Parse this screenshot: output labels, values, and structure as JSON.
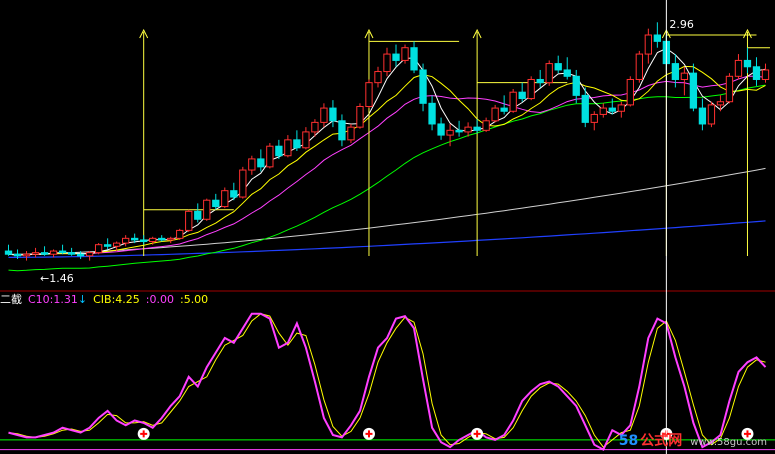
{
  "colors": {
    "background": "#000000",
    "up_candle": "#ff3030",
    "down_candle": "#00e0e0",
    "ma5": "#ffffff",
    "ma10": "#ffff00",
    "ma20": "#ff40ff",
    "ma60": "#00ff00",
    "ma120": "#d0d0d0",
    "ma250": "#2040ff",
    "signal": "#ffff40",
    "indicator_line": "#ff40ff",
    "indicator_signal": "#ffff00",
    "green_level": "#00ff00",
    "magenta_level": "#ff40ff"
  },
  "price_panel": {
    "max_label": "2.96",
    "min_label": "1.46",
    "min_arrow": "←"
  },
  "indicator_panel": {
    "name": "二截",
    "c10_label": "C10:1.31",
    "c10_arrow": "↓",
    "cib_label": "CIB:4.25",
    "v1_label": ":0.00",
    "v2_label": ":5.00"
  },
  "watermark": {
    "num": "58",
    "cn": "公式网",
    "url": "www.58gu.com"
  },
  "chart_data": {
    "type": "candlestick",
    "price_ylim": [
      1.3,
      3.05
    ],
    "indicator_ylim": [
      -0.5,
      5.6
    ],
    "ohlc": [
      [
        1.52,
        1.56,
        1.49,
        1.5
      ],
      [
        1.5,
        1.53,
        1.47,
        1.49
      ],
      [
        1.49,
        1.52,
        1.46,
        1.5
      ],
      [
        1.5,
        1.54,
        1.48,
        1.51
      ],
      [
        1.51,
        1.55,
        1.49,
        1.5
      ],
      [
        1.5,
        1.53,
        1.48,
        1.52
      ],
      [
        1.52,
        1.56,
        1.5,
        1.51
      ],
      [
        1.51,
        1.54,
        1.49,
        1.5
      ],
      [
        1.5,
        1.52,
        1.47,
        1.49
      ],
      [
        1.49,
        1.52,
        1.46,
        1.51
      ],
      [
        1.51,
        1.57,
        1.5,
        1.56
      ],
      [
        1.56,
        1.6,
        1.53,
        1.55
      ],
      [
        1.55,
        1.58,
        1.52,
        1.57
      ],
      [
        1.57,
        1.62,
        1.55,
        1.6
      ],
      [
        1.6,
        1.63,
        1.57,
        1.59
      ],
      [
        1.59,
        1.62,
        1.56,
        1.58
      ],
      [
        1.58,
        1.61,
        1.56,
        1.6
      ],
      [
        1.6,
        1.62,
        1.58,
        1.59
      ],
      [
        1.59,
        1.61,
        1.57,
        1.6
      ],
      [
        1.6,
        1.66,
        1.59,
        1.65
      ],
      [
        1.65,
        1.78,
        1.64,
        1.77
      ],
      [
        1.77,
        1.82,
        1.7,
        1.72
      ],
      [
        1.72,
        1.85,
        1.71,
        1.84
      ],
      [
        1.84,
        1.88,
        1.78,
        1.8
      ],
      [
        1.8,
        1.92,
        1.79,
        1.9
      ],
      [
        1.9,
        1.95,
        1.84,
        1.86
      ],
      [
        1.86,
        2.05,
        1.85,
        2.03
      ],
      [
        2.03,
        2.12,
        2.0,
        2.1
      ],
      [
        2.1,
        2.16,
        2.02,
        2.05
      ],
      [
        2.05,
        2.2,
        2.04,
        2.18
      ],
      [
        2.18,
        2.22,
        2.1,
        2.12
      ],
      [
        2.12,
        2.25,
        2.11,
        2.22
      ],
      [
        2.22,
        2.28,
        2.15,
        2.17
      ],
      [
        2.17,
        2.3,
        2.16,
        2.27
      ],
      [
        2.27,
        2.35,
        2.24,
        2.33
      ],
      [
        2.33,
        2.45,
        2.3,
        2.42
      ],
      [
        2.42,
        2.47,
        2.3,
        2.34
      ],
      [
        2.34,
        2.38,
        2.18,
        2.22
      ],
      [
        2.22,
        2.32,
        2.2,
        2.3
      ],
      [
        2.3,
        2.45,
        2.29,
        2.43
      ],
      [
        2.43,
        2.6,
        2.42,
        2.58
      ],
      [
        2.58,
        2.68,
        2.55,
        2.65
      ],
      [
        2.65,
        2.8,
        2.62,
        2.76
      ],
      [
        2.76,
        2.82,
        2.68,
        2.72
      ],
      [
        2.72,
        2.82,
        2.7,
        2.8
      ],
      [
        2.8,
        2.84,
        2.64,
        2.66
      ],
      [
        2.66,
        2.7,
        2.4,
        2.45
      ],
      [
        2.45,
        2.5,
        2.28,
        2.32
      ],
      [
        2.32,
        2.36,
        2.22,
        2.25
      ],
      [
        2.25,
        2.32,
        2.18,
        2.28
      ],
      [
        2.28,
        2.34,
        2.24,
        2.27
      ],
      [
        2.27,
        2.33,
        2.24,
        2.3
      ],
      [
        2.3,
        2.35,
        2.26,
        2.28
      ],
      [
        2.28,
        2.36,
        2.27,
        2.34
      ],
      [
        2.34,
        2.44,
        2.33,
        2.42
      ],
      [
        2.42,
        2.5,
        2.38,
        2.4
      ],
      [
        2.4,
        2.54,
        2.39,
        2.52
      ],
      [
        2.52,
        2.58,
        2.46,
        2.48
      ],
      [
        2.48,
        2.62,
        2.47,
        2.6
      ],
      [
        2.6,
        2.66,
        2.55,
        2.58
      ],
      [
        2.58,
        2.72,
        2.56,
        2.7
      ],
      [
        2.7,
        2.75,
        2.64,
        2.66
      ],
      [
        2.66,
        2.74,
        2.6,
        2.62
      ],
      [
        2.62,
        2.66,
        2.45,
        2.5
      ],
      [
        2.5,
        2.55,
        2.3,
        2.33
      ],
      [
        2.33,
        2.4,
        2.28,
        2.38
      ],
      [
        2.38,
        2.45,
        2.36,
        2.42
      ],
      [
        2.42,
        2.48,
        2.38,
        2.4
      ],
      [
        2.4,
        2.46,
        2.36,
        2.44
      ],
      [
        2.44,
        2.62,
        2.43,
        2.6
      ],
      [
        2.6,
        2.78,
        2.58,
        2.76
      ],
      [
        2.76,
        2.92,
        2.7,
        2.88
      ],
      [
        2.88,
        2.96,
        2.8,
        2.84
      ],
      [
        2.84,
        2.88,
        2.66,
        2.7
      ],
      [
        2.7,
        2.76,
        2.55,
        2.6
      ],
      [
        2.6,
        2.68,
        2.5,
        2.64
      ],
      [
        2.64,
        2.7,
        2.4,
        2.42
      ],
      [
        2.42,
        2.48,
        2.28,
        2.32
      ],
      [
        2.32,
        2.46,
        2.3,
        2.44
      ],
      [
        2.44,
        2.5,
        2.4,
        2.46
      ],
      [
        2.46,
        2.64,
        2.45,
        2.62
      ],
      [
        2.62,
        2.76,
        2.6,
        2.72
      ],
      [
        2.72,
        2.8,
        2.64,
        2.68
      ],
      [
        2.68,
        2.74,
        2.56,
        2.6
      ],
      [
        2.6,
        2.7,
        2.58,
        2.66
      ]
    ],
    "indicator_values": [
      0.3,
      0.2,
      0.1,
      0.1,
      0.2,
      0.3,
      0.5,
      0.4,
      0.3,
      0.5,
      0.9,
      1.2,
      0.8,
      0.6,
      0.8,
      0.7,
      0.5,
      0.9,
      1.4,
      1.8,
      2.6,
      2.2,
      3.0,
      3.6,
      4.2,
      4.0,
      4.6,
      5.2,
      5.2,
      5.0,
      3.8,
      4.0,
      4.8,
      3.8,
      2.4,
      0.9,
      0.2,
      0.1,
      0.6,
      1.2,
      2.6,
      3.8,
      4.2,
      5.0,
      5.1,
      4.6,
      2.5,
      0.5,
      -0.1,
      -0.3,
      0.0,
      0.2,
      0.4,
      0.1,
      0.0,
      0.2,
      0.8,
      1.6,
      2.0,
      2.3,
      2.4,
      2.2,
      1.8,
      1.4,
      0.6,
      -0.2,
      -0.4,
      0.4,
      0.2,
      0.6,
      2.2,
      4.2,
      5.0,
      4.8,
      3.4,
      2.2,
      0.7,
      -0.3,
      -0.1,
      0.2,
      1.6,
      2.8,
      3.2,
      3.4,
      3.0
    ],
    "green_level": 0.0,
    "magenta_level": -0.4,
    "signal_bars": [
      15,
      40,
      52,
      73,
      82
    ],
    "signal_markers": [
      15,
      40,
      52,
      73,
      82
    ],
    "markers": [
      15,
      40,
      52,
      73,
      82
    ],
    "cursor_index": 73
  }
}
